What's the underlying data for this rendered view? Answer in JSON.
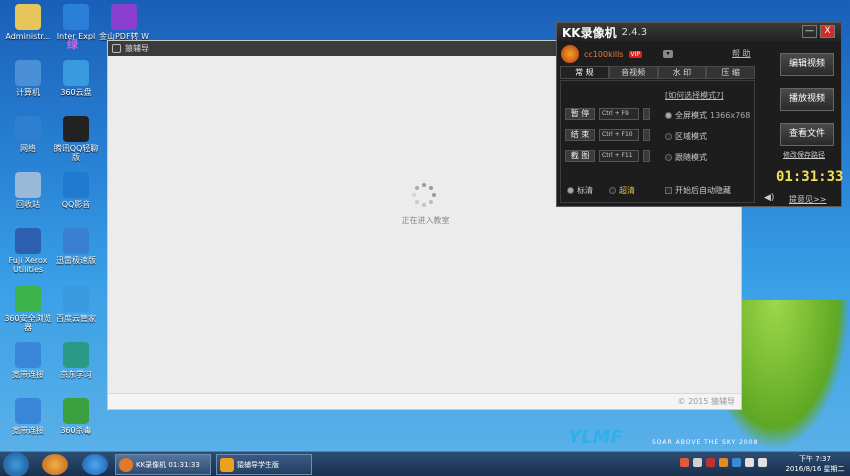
{
  "desktop": {
    "icons": [
      {
        "label": "Administr...",
        "color": "#e6c65a"
      },
      {
        "label": "Inter Expl",
        "color": "#2a7fd8"
      },
      {
        "label": "金山PDF转 W",
        "color": "#8a3fd0"
      },
      {
        "label": "计算机",
        "color": "#4a8fd6"
      },
      {
        "label": "360云盘",
        "color": "#3a9ae0"
      },
      {
        "label": "网络",
        "color": "#2e7fd0"
      },
      {
        "label": "腾讯QQ轻聊版",
        "color": "#222222"
      },
      {
        "label": "回收站",
        "color": "#9ab8d8"
      },
      {
        "label": "QQ影音",
        "color": "#1f7ad0"
      },
      {
        "label": "Fuji Xerox Utilities",
        "color": "#2c5fb0"
      },
      {
        "label": "迅雷极速版",
        "color": "#3a7fd0"
      },
      {
        "label": "360安全浏览器",
        "color": "#3bb34a"
      },
      {
        "label": "百度云管家",
        "color": "#3a9ae0"
      },
      {
        "label": "宽带连接",
        "color": "#3a86d8"
      },
      {
        "label": "京东学习",
        "color": "#2a9a88"
      },
      {
        "label": "宽带连接",
        "color": "#3a86d8"
      },
      {
        "label": "360杀毒",
        "color": "#3aa040"
      }
    ],
    "watermark": "绿"
  },
  "main_window": {
    "title": "猿辅导",
    "loading_text": "正在进入教室",
    "copyright": "© 2015  猿辅导"
  },
  "kk": {
    "title": "KK录像机",
    "version": "2.4.3",
    "minimize": "—",
    "close": "X",
    "username": "cc100kills",
    "vip": "VIP",
    "help": "帮 助",
    "tabs": [
      "常  规",
      "音视频",
      "水  印",
      "压  缩"
    ],
    "mode_link": "[如何选择模式?]",
    "hotkeys": [
      {
        "label": "暂 停",
        "key": "Ctrl + F9"
      },
      {
        "label": "结 束",
        "key": "Ctrl + F10"
      },
      {
        "label": "截 图",
        "key": "Ctrl + F11"
      }
    ],
    "modes": [
      {
        "label": "全屏模式",
        "detail": "1366x768",
        "selected": true
      },
      {
        "label": "区域模式",
        "detail": "",
        "selected": false
      },
      {
        "label": "跟随模式",
        "detail": "",
        "selected": false
      }
    ],
    "quality": [
      {
        "label": "标清",
        "selected": true
      },
      {
        "label": "超清",
        "selected": false
      }
    ],
    "auto_hide": "开始后自动隐藏",
    "buttons": [
      "编辑视频",
      "播放视频",
      "查看文件"
    ],
    "save_path": "修改保存路径",
    "timer": "01:31:33",
    "tips": "提意见>>"
  },
  "taskbar": {
    "items": [
      {
        "label": "KK录像机 01:31:33"
      },
      {
        "label": "猿辅导学生版"
      }
    ],
    "clock_time": "下午 7:37",
    "clock_date": "2016/8/16 星期二"
  },
  "wallpaper": {
    "brand": "YLMF",
    "slogan": "SOAR ABOVE THE SKY 2008"
  }
}
